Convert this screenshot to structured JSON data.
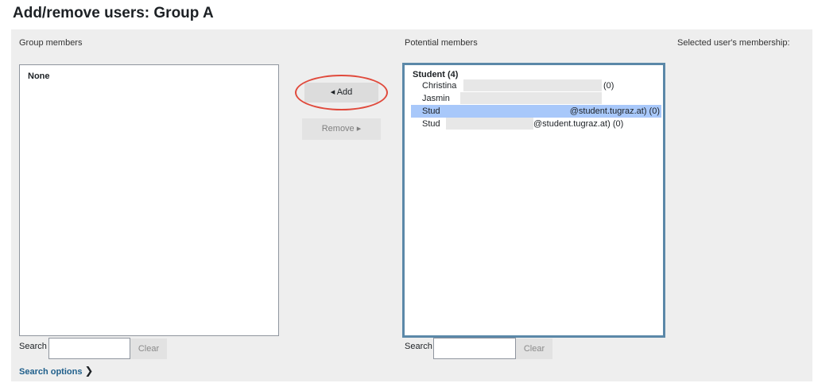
{
  "page": {
    "title": "Add/remove users: Group A"
  },
  "columns": {
    "group_members_label": "Group members",
    "potential_members_label": "Potential members",
    "selected_membership_label": "Selected user's membership:"
  },
  "group_members": {
    "items": [
      "None"
    ]
  },
  "buttons": {
    "add_label": "◂ Add",
    "remove_label": "Remove ▸"
  },
  "potential_members": {
    "group_label": "Student (4)",
    "items": [
      {
        "prefix": "Christina",
        "suffix": "(0)",
        "selected": false
      },
      {
        "prefix": "Jasmin",
        "suffix": "",
        "selected": false
      },
      {
        "prefix": "Stud",
        "suffix": "@student.tugraz.at) (0)",
        "selected": true
      },
      {
        "prefix": "Stud",
        "suffix": "@student.tugraz.at) (0)",
        "selected": false
      }
    ]
  },
  "search_left": {
    "label": "Search",
    "value": "",
    "clear_label": "Clear"
  },
  "search_right": {
    "label": "Search",
    "value": "",
    "clear_label": "Clear"
  },
  "search_options": {
    "label": "Search options"
  },
  "colors": {
    "selected_row": "#a8c8fa",
    "focus_border": "#5b88a8",
    "highlight_ring": "#e04a3c",
    "link": "#1f5f8b"
  }
}
